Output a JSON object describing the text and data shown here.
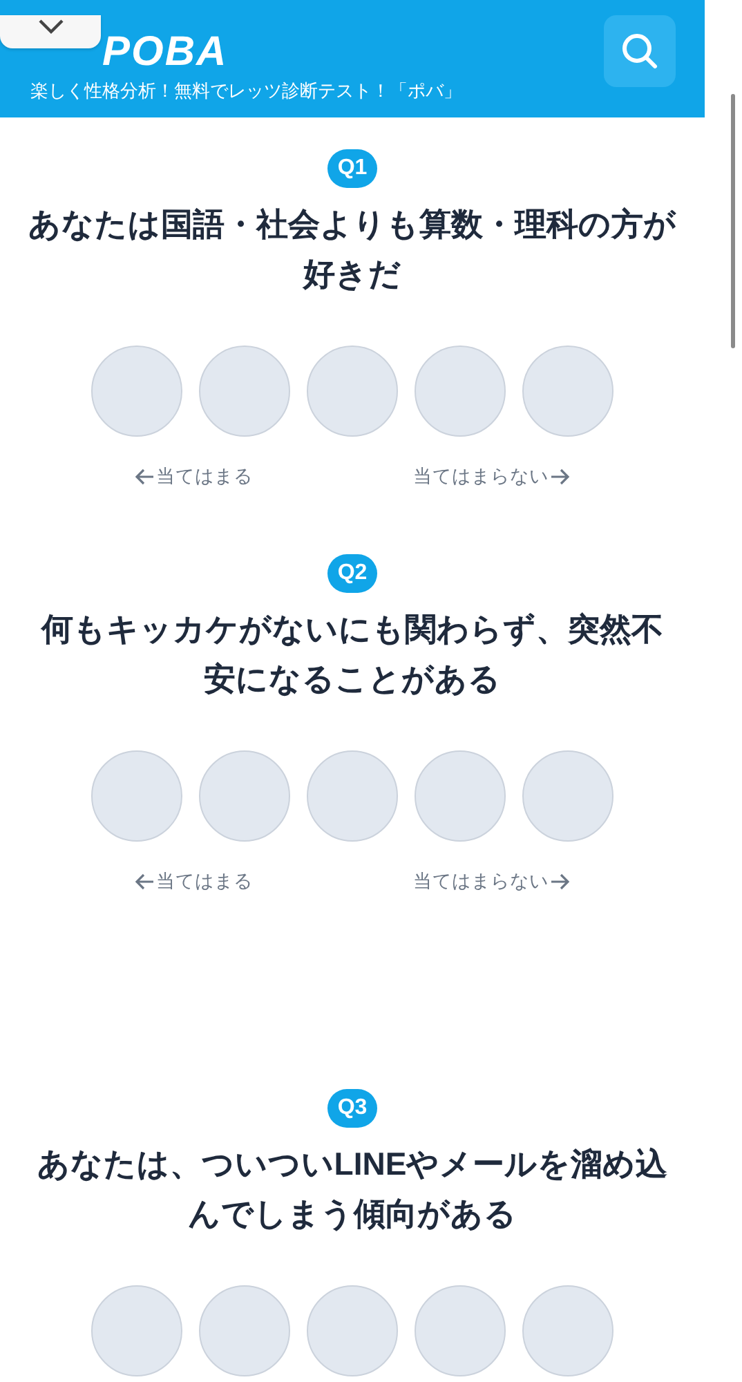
{
  "header": {
    "logo": "POBA",
    "tagline": "楽しく性格分析！無料でレッツ診断テスト！「ポバ」"
  },
  "questions": [
    {
      "number": "Q1",
      "text": "あなたは国語・社会よりも算数・理科の方が好きだ",
      "choices": [
        {
          "selected": false
        },
        {
          "selected": false
        },
        {
          "selected": false
        },
        {
          "selected": false
        },
        {
          "selected": false
        }
      ],
      "agree_label": "当てはまる",
      "disagree_label": "当てはまらない"
    },
    {
      "number": "Q2",
      "text": "何もキッカケがないにも関わらず、突然不安になることがある",
      "choices": [
        {
          "selected": false
        },
        {
          "selected": false
        },
        {
          "selected": false
        },
        {
          "selected": false
        },
        {
          "selected": false
        }
      ],
      "agree_label": "当てはまる",
      "disagree_label": "当てはまらない"
    },
    {
      "number": "Q3",
      "text": "あなたは、ついついLINEやメールを溜め込んでしまう傾向がある",
      "choices": [
        {
          "selected": false
        },
        {
          "selected": false
        },
        {
          "selected": false
        },
        {
          "selected": false
        },
        {
          "selected": false
        }
      ]
    }
  ]
}
